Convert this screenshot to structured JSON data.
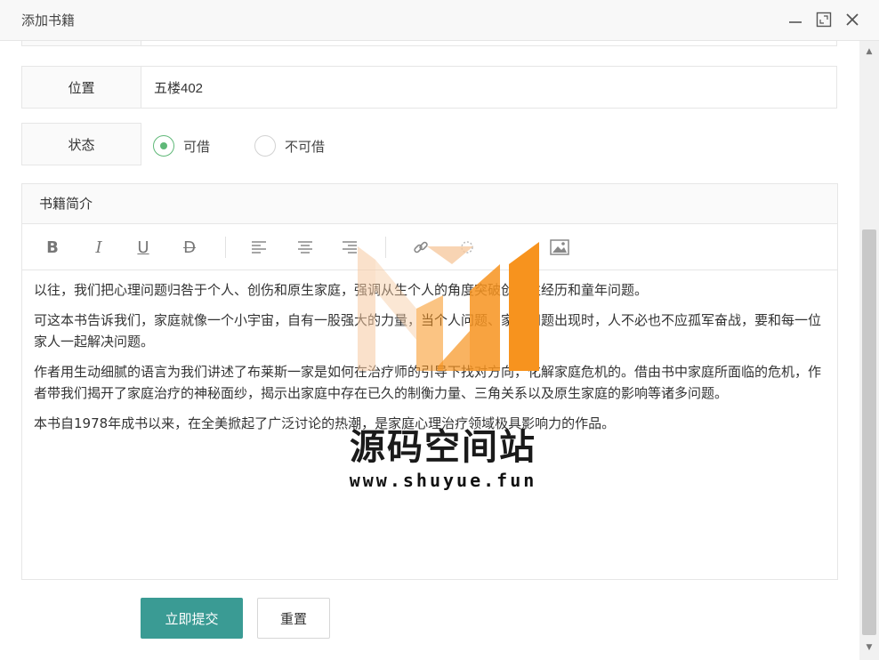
{
  "window": {
    "title": "添加书籍"
  },
  "form": {
    "location": {
      "label": "位置",
      "value": "五楼402"
    },
    "status": {
      "label": "状态",
      "options": [
        "可借",
        "不可借"
      ],
      "selected": "可借"
    },
    "intro": {
      "label": "书籍简介",
      "paragraphs": [
        "以往，我们把心理问题归咎于个人、创伤和原生家庭，强调从生个人的角度突破创伤性经历和童年问题。",
        "可这本书告诉我们，家庭就像一个小宇宙，自有一股强大的力量，当个人问题、家庭问题出现时，人不必也不应孤军奋战，要和每一位家人一起解决问题。",
        "作者用生动细腻的语言为我们讲述了布莱斯一家是如何在治疗师的引导下找对方向，化解家庭危机的。借由书中家庭所面临的危机，作者带我们揭开了家庭治疗的神秘面纱，揭示出家庭中存在已久的制衡力量、三角关系以及原生家庭的影响等诸多问题。",
        "本书自1978年成书以来，在全美掀起了广泛讨论的热潮，是家庭心理治疗领域极具影响力的作品。"
      ]
    },
    "buttons": {
      "submit": "立即提交",
      "reset": "重置"
    }
  },
  "toolbar_icons": [
    "bold-icon",
    "italic-icon",
    "underline-icon",
    "strikethrough-icon",
    "align-left-icon",
    "align-center-icon",
    "align-right-icon",
    "link-icon",
    "unlink-icon",
    "image-icon"
  ],
  "toolbar_labels": {
    "bold": "B",
    "italic": "I",
    "underline": "U",
    "strike": "D"
  },
  "watermark": {
    "name": "源码空间站",
    "url": "www.shuyue.fun"
  },
  "colors": {
    "accent": "#3a9b94",
    "radio_active": "#5fb878",
    "logo_orange": "#f7931e",
    "logo_peach": "#f6c9a0"
  }
}
